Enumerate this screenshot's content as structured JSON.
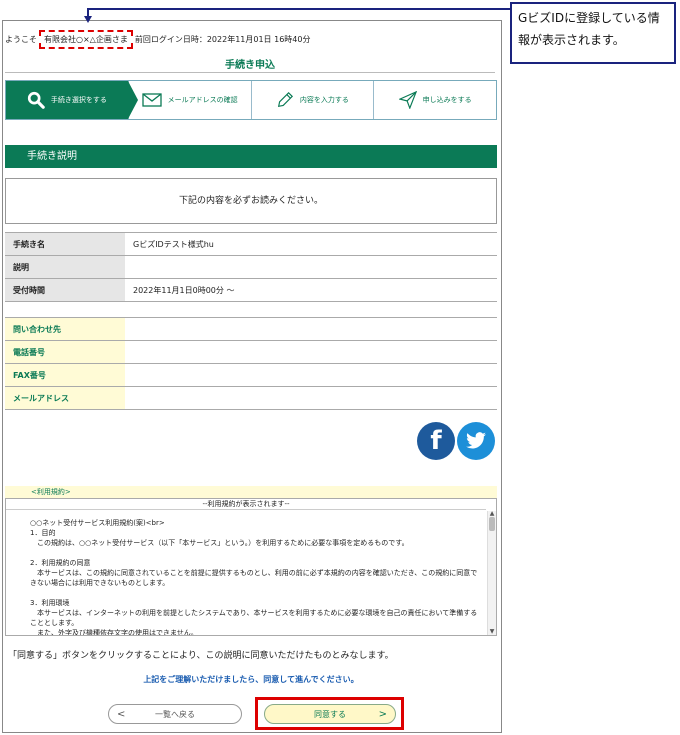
{
  "header": {
    "welcome": "ようこそ",
    "company": "有限会社○×△企画さま",
    "last_login_label": "前回ログイン日時：",
    "last_login_value": "2022年11月01日 16時40分"
  },
  "callout": {
    "text": "GビズIDに登録している情報が表示されます。"
  },
  "page_title": "手続き申込",
  "steps": [
    {
      "label": "手続き選択をする",
      "icon": "search-icon",
      "active": true
    },
    {
      "label": "メールアドレスの確認",
      "icon": "mail-icon",
      "active": false
    },
    {
      "label": "内容を入力する",
      "icon": "pencil-icon",
      "active": false
    },
    {
      "label": "申し込みをする",
      "icon": "send-icon",
      "active": false
    }
  ],
  "section_title": "手続き説明",
  "notice": "下記の内容を必ずお読みください。",
  "procedure": {
    "name_label": "手続き名",
    "name_value": "GビズIDテスト様式hu",
    "desc_label": "説明",
    "desc_value": "",
    "period_label": "受付時間",
    "period_value": "2022年11月1日0時00分 ～"
  },
  "contact": {
    "inquiry_label": "問い合わせ先",
    "phone_label": "電話番号",
    "fax_label": "FAX番号",
    "email_label": "メールアドレス"
  },
  "social": {
    "facebook_glyph": "f",
    "twitter_glyph": "t"
  },
  "terms": {
    "label": "<利用規約>",
    "header": "--利用規約が表示されます--",
    "paragraphs": [
      "○○ネット受付サービス利用規約(案)<br>\n1．目的\n　この規約は、○○ネット受付サービス（以下「本サービス」という。）を利用するために必要な事項を定めるものです。",
      "2．利用規約の同意\n　本サービスは、この規約に同意されていることを前提に提供するものとし、利用の前に必ず本規約の内容を確認いただき、この規約に同意できない場合には利用できないものとします。",
      "3．利用環境\n　本サービスは、インターネットの利用を前提としたシステムであり、本サービスを利用するために必要な環境を自己の責任において準備することとします。\n　また、外字及び機種依存文字の使用はできません。"
    ]
  },
  "agree_note": "「同意する」ボタンをクリックすることにより、この説明に同意いただけたものとみなします。",
  "proceed_note": "上記をご理解いただけましたら、同意して進んでください。",
  "buttons": {
    "back": "一覧へ戻る",
    "agree": "同意する"
  }
}
